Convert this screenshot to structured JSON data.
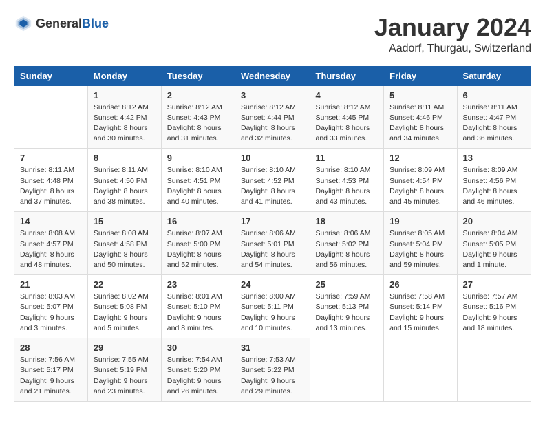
{
  "header": {
    "logo_general": "General",
    "logo_blue": "Blue",
    "month": "January 2024",
    "location": "Aadorf, Thurgau, Switzerland"
  },
  "weekdays": [
    "Sunday",
    "Monday",
    "Tuesday",
    "Wednesday",
    "Thursday",
    "Friday",
    "Saturday"
  ],
  "weeks": [
    [
      {
        "day": "",
        "sunrise": "",
        "sunset": "",
        "daylight": ""
      },
      {
        "day": "1",
        "sunrise": "Sunrise: 8:12 AM",
        "sunset": "Sunset: 4:42 PM",
        "daylight": "Daylight: 8 hours and 30 minutes."
      },
      {
        "day": "2",
        "sunrise": "Sunrise: 8:12 AM",
        "sunset": "Sunset: 4:43 PM",
        "daylight": "Daylight: 8 hours and 31 minutes."
      },
      {
        "day": "3",
        "sunrise": "Sunrise: 8:12 AM",
        "sunset": "Sunset: 4:44 PM",
        "daylight": "Daylight: 8 hours and 32 minutes."
      },
      {
        "day": "4",
        "sunrise": "Sunrise: 8:12 AM",
        "sunset": "Sunset: 4:45 PM",
        "daylight": "Daylight: 8 hours and 33 minutes."
      },
      {
        "day": "5",
        "sunrise": "Sunrise: 8:11 AM",
        "sunset": "Sunset: 4:46 PM",
        "daylight": "Daylight: 8 hours and 34 minutes."
      },
      {
        "day": "6",
        "sunrise": "Sunrise: 8:11 AM",
        "sunset": "Sunset: 4:47 PM",
        "daylight": "Daylight: 8 hours and 36 minutes."
      }
    ],
    [
      {
        "day": "7",
        "sunrise": "Sunrise: 8:11 AM",
        "sunset": "Sunset: 4:48 PM",
        "daylight": "Daylight: 8 hours and 37 minutes."
      },
      {
        "day": "8",
        "sunrise": "Sunrise: 8:11 AM",
        "sunset": "Sunset: 4:50 PM",
        "daylight": "Daylight: 8 hours and 38 minutes."
      },
      {
        "day": "9",
        "sunrise": "Sunrise: 8:10 AM",
        "sunset": "Sunset: 4:51 PM",
        "daylight": "Daylight: 8 hours and 40 minutes."
      },
      {
        "day": "10",
        "sunrise": "Sunrise: 8:10 AM",
        "sunset": "Sunset: 4:52 PM",
        "daylight": "Daylight: 8 hours and 41 minutes."
      },
      {
        "day": "11",
        "sunrise": "Sunrise: 8:10 AM",
        "sunset": "Sunset: 4:53 PM",
        "daylight": "Daylight: 8 hours and 43 minutes."
      },
      {
        "day": "12",
        "sunrise": "Sunrise: 8:09 AM",
        "sunset": "Sunset: 4:54 PM",
        "daylight": "Daylight: 8 hours and 45 minutes."
      },
      {
        "day": "13",
        "sunrise": "Sunrise: 8:09 AM",
        "sunset": "Sunset: 4:56 PM",
        "daylight": "Daylight: 8 hours and 46 minutes."
      }
    ],
    [
      {
        "day": "14",
        "sunrise": "Sunrise: 8:08 AM",
        "sunset": "Sunset: 4:57 PM",
        "daylight": "Daylight: 8 hours and 48 minutes."
      },
      {
        "day": "15",
        "sunrise": "Sunrise: 8:08 AM",
        "sunset": "Sunset: 4:58 PM",
        "daylight": "Daylight: 8 hours and 50 minutes."
      },
      {
        "day": "16",
        "sunrise": "Sunrise: 8:07 AM",
        "sunset": "Sunset: 5:00 PM",
        "daylight": "Daylight: 8 hours and 52 minutes."
      },
      {
        "day": "17",
        "sunrise": "Sunrise: 8:06 AM",
        "sunset": "Sunset: 5:01 PM",
        "daylight": "Daylight: 8 hours and 54 minutes."
      },
      {
        "day": "18",
        "sunrise": "Sunrise: 8:06 AM",
        "sunset": "Sunset: 5:02 PM",
        "daylight": "Daylight: 8 hours and 56 minutes."
      },
      {
        "day": "19",
        "sunrise": "Sunrise: 8:05 AM",
        "sunset": "Sunset: 5:04 PM",
        "daylight": "Daylight: 8 hours and 59 minutes."
      },
      {
        "day": "20",
        "sunrise": "Sunrise: 8:04 AM",
        "sunset": "Sunset: 5:05 PM",
        "daylight": "Daylight: 9 hours and 1 minute."
      }
    ],
    [
      {
        "day": "21",
        "sunrise": "Sunrise: 8:03 AM",
        "sunset": "Sunset: 5:07 PM",
        "daylight": "Daylight: 9 hours and 3 minutes."
      },
      {
        "day": "22",
        "sunrise": "Sunrise: 8:02 AM",
        "sunset": "Sunset: 5:08 PM",
        "daylight": "Daylight: 9 hours and 5 minutes."
      },
      {
        "day": "23",
        "sunrise": "Sunrise: 8:01 AM",
        "sunset": "Sunset: 5:10 PM",
        "daylight": "Daylight: 9 hours and 8 minutes."
      },
      {
        "day": "24",
        "sunrise": "Sunrise: 8:00 AM",
        "sunset": "Sunset: 5:11 PM",
        "daylight": "Daylight: 9 hours and 10 minutes."
      },
      {
        "day": "25",
        "sunrise": "Sunrise: 7:59 AM",
        "sunset": "Sunset: 5:13 PM",
        "daylight": "Daylight: 9 hours and 13 minutes."
      },
      {
        "day": "26",
        "sunrise": "Sunrise: 7:58 AM",
        "sunset": "Sunset: 5:14 PM",
        "daylight": "Daylight: 9 hours and 15 minutes."
      },
      {
        "day": "27",
        "sunrise": "Sunrise: 7:57 AM",
        "sunset": "Sunset: 5:16 PM",
        "daylight": "Daylight: 9 hours and 18 minutes."
      }
    ],
    [
      {
        "day": "28",
        "sunrise": "Sunrise: 7:56 AM",
        "sunset": "Sunset: 5:17 PM",
        "daylight": "Daylight: 9 hours and 21 minutes."
      },
      {
        "day": "29",
        "sunrise": "Sunrise: 7:55 AM",
        "sunset": "Sunset: 5:19 PM",
        "daylight": "Daylight: 9 hours and 23 minutes."
      },
      {
        "day": "30",
        "sunrise": "Sunrise: 7:54 AM",
        "sunset": "Sunset: 5:20 PM",
        "daylight": "Daylight: 9 hours and 26 minutes."
      },
      {
        "day": "31",
        "sunrise": "Sunrise: 7:53 AM",
        "sunset": "Sunset: 5:22 PM",
        "daylight": "Daylight: 9 hours and 29 minutes."
      },
      {
        "day": "",
        "sunrise": "",
        "sunset": "",
        "daylight": ""
      },
      {
        "day": "",
        "sunrise": "",
        "sunset": "",
        "daylight": ""
      },
      {
        "day": "",
        "sunrise": "",
        "sunset": "",
        "daylight": ""
      }
    ]
  ]
}
